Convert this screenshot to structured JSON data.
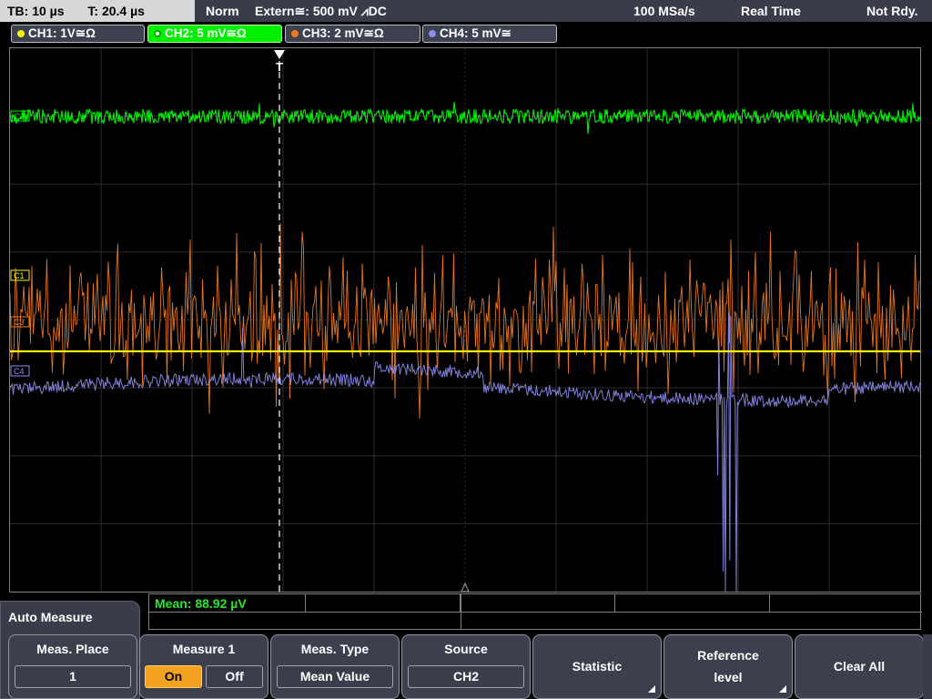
{
  "status_bar": {
    "timebase": "TB: 10 µs",
    "trigger_time": "T: 20.4 µs",
    "mode": "Norm",
    "trigger_source": "Extern≅: 500 mV ⩘DC",
    "sample_rate": "100 MSa/s",
    "acq_mode": "Real Time",
    "state": "Not Rdy."
  },
  "channels": [
    {
      "label": "CH1: 1V≅Ω",
      "color": "#f4f40a"
    },
    {
      "label": "CH2: 5 mV≅Ω",
      "color": "#00ee00"
    },
    {
      "label": "CH3: 2 mV≅Ω",
      "color": "#f07a21"
    },
    {
      "label": "CH4: 5 mV≅",
      "color": "#8d8df0"
    }
  ],
  "markers": {
    "c1": "C1",
    "c2": "C2",
    "c3": "C3",
    "c4": "C4",
    "trigger": "T"
  },
  "measurement": {
    "mean": "Mean: 88.92 µV"
  },
  "menu": {
    "title": "Auto Measure",
    "meas_place": {
      "label": "Meas. Place",
      "value": "1"
    },
    "measure": {
      "label": "Measure 1",
      "on": "On",
      "off": "Off"
    },
    "meas_type": {
      "label": "Meas. Type",
      "value": "Mean Value"
    },
    "source": {
      "label": "Source",
      "value": "CH2"
    },
    "statistic": {
      "label": "Statistic"
    },
    "reference": {
      "label1": "Reference",
      "label2": "level"
    },
    "clear_all": {
      "label": "Clear All"
    }
  }
}
